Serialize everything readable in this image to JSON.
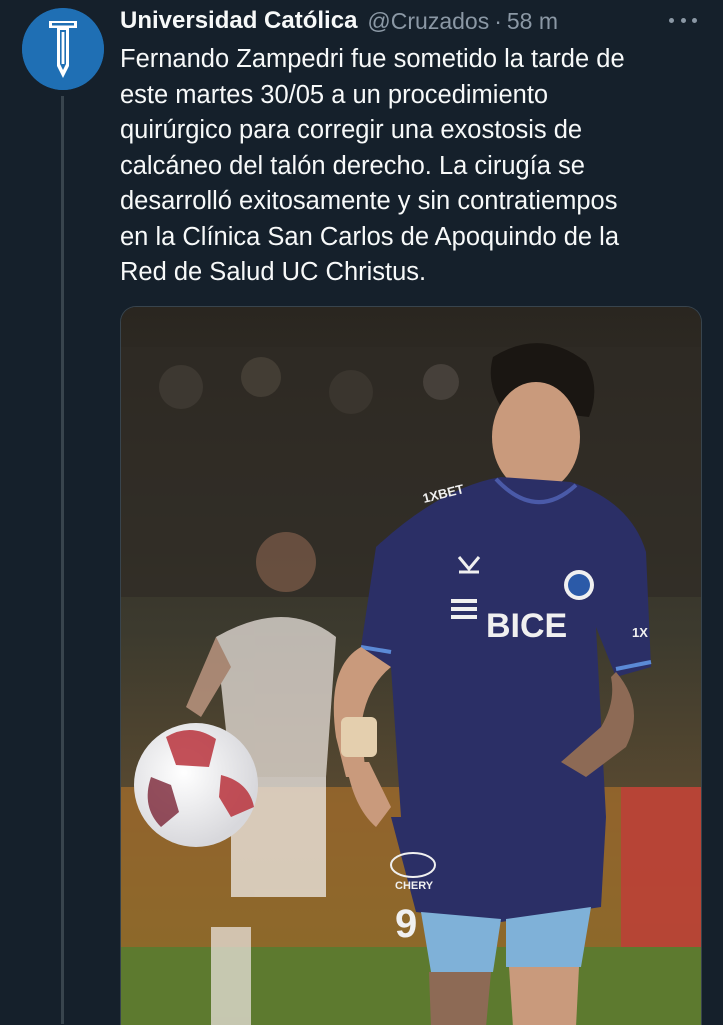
{
  "tweet": {
    "author_name": "Universidad Católica",
    "author_handle": "@Cruzados",
    "separator": "·",
    "timestamp": "58 m",
    "text_lines": [
      "Fernando Zampedri fue sometido la tarde de",
      "este martes 30/05 a un procedimiento",
      "quirúrgico para corregir una exostosis de",
      "calcáneo del talón derecho. La cirugía se",
      "desarrolló exitosamente y sin contratiempos",
      "en la Clínica San Carlos de Apoquindo de la",
      "Red de Salud UC Christus."
    ],
    "more_icon": "more-horizontal-icon",
    "photo": {
      "jersey_sponsor": "BICE",
      "chest_brand": "1XBET",
      "shorts_sponsor": "CHERY",
      "shorts_number": "9",
      "sleeve_text": "1X"
    }
  },
  "colors": {
    "background": "#15202b",
    "text_primary": "#f7f9f9",
    "text_secondary": "#8b98a5",
    "avatar_blue": "#1f6fb4",
    "jersey_navy": "#2b2f66",
    "shorts_light_blue": "#7fb1d8"
  }
}
